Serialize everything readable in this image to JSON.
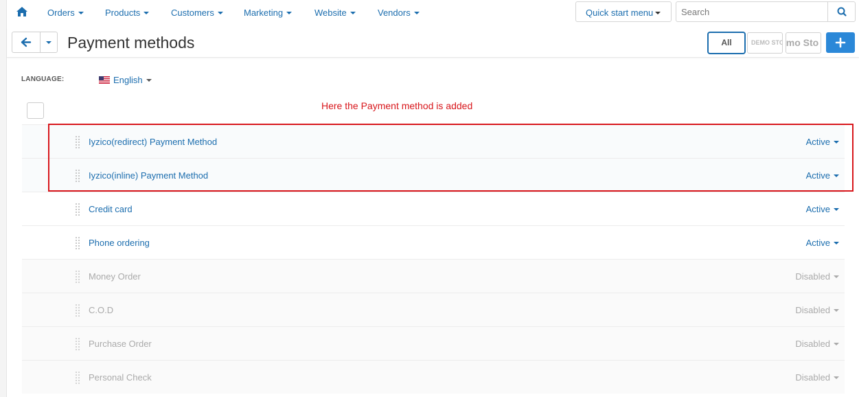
{
  "nav": {
    "items": [
      {
        "label": "Orders"
      },
      {
        "label": "Products"
      },
      {
        "label": "Customers"
      },
      {
        "label": "Marketing"
      },
      {
        "label": "Website"
      },
      {
        "label": "Vendors"
      }
    ],
    "quick_start_label": "Quick start menu",
    "search_placeholder": "Search"
  },
  "header": {
    "title": "Payment methods",
    "stores": {
      "all_label": "All",
      "demo1_label": "DEMO STO",
      "demo2_label": "emo Sto"
    },
    "add_label": "+"
  },
  "language": {
    "label": "LANGUAGE:",
    "selected": "English"
  },
  "annotation": "Here the Payment method is added",
  "methods": [
    {
      "name": "Iyzico(redirect) Payment Method",
      "status": "Active"
    },
    {
      "name": "Iyzico(inline) Payment Method",
      "status": "Active"
    },
    {
      "name": "Credit card",
      "status": "Active"
    },
    {
      "name": "Phone ordering",
      "status": "Active"
    },
    {
      "name": "Money Order",
      "status": "Disabled"
    },
    {
      "name": "C.O.D",
      "status": "Disabled"
    },
    {
      "name": "Purchase Order",
      "status": "Disabled"
    },
    {
      "name": "Personal Check",
      "status": "Disabled"
    }
  ],
  "colors": {
    "link": "#1b6dae",
    "annotation": "#d8161b",
    "primary_button": "#2b88d8",
    "disabled_text": "#aaaaaa"
  }
}
